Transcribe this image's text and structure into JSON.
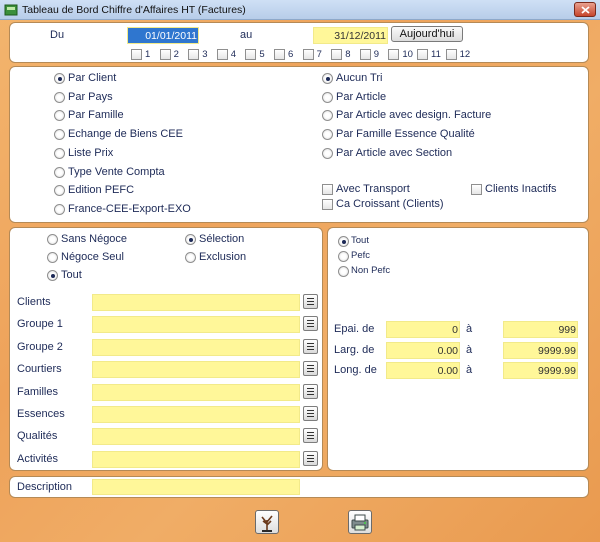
{
  "window": {
    "title": "Tableau de Bord Chiffre d'Affaires HT (Factures)"
  },
  "dates": {
    "du_label": "Du",
    "du_value": "01/01/2011",
    "au_label": "au",
    "au_value": "31/12/2011",
    "today_button": "Aujourd'hui"
  },
  "months": [
    "1",
    "2",
    "3",
    "4",
    "5",
    "6",
    "7",
    "8",
    "9",
    "10",
    "11",
    "12"
  ],
  "grouping": {
    "left": [
      {
        "label": "Par Client",
        "selected": true
      },
      {
        "label": "Par Pays",
        "selected": false
      },
      {
        "label": "Par Famille",
        "selected": false
      },
      {
        "label": "Echange de Biens CEE",
        "selected": false
      },
      {
        "label": "Liste Prix",
        "selected": false
      },
      {
        "label": "Type Vente Compta",
        "selected": false
      },
      {
        "label": "Edition PEFC",
        "selected": false
      },
      {
        "label": "France-CEE-Export-EXO",
        "selected": false
      }
    ],
    "sort": [
      {
        "label": "Aucun Tri",
        "selected": true
      },
      {
        "label": "Par Article",
        "selected": false
      },
      {
        "label": "Par Article avec design. Facture",
        "selected": false
      },
      {
        "label": "Par Famille Essence Qualité",
        "selected": false
      },
      {
        "label": "Par Article avec Section",
        "selected": false
      }
    ],
    "checks": {
      "avec_transport": "Avec Transport",
      "clients_inactifs": "Clients Inactifs",
      "ca_croissant": "Ca Croissant (Clients)"
    }
  },
  "negoce": {
    "sans_negoce": "Sans Négoce",
    "negoce_seul": "Négoce Seul",
    "tout": "Tout",
    "selection": "Sélection",
    "exclusion": "Exclusion"
  },
  "filters": [
    {
      "label": "Clients",
      "value": ""
    },
    {
      "label": "Groupe 1",
      "value": ""
    },
    {
      "label": "Groupe 2",
      "value": ""
    },
    {
      "label": "Courtiers",
      "value": ""
    },
    {
      "label": "Familles",
      "value": ""
    },
    {
      "label": "Essences",
      "value": ""
    },
    {
      "label": "Qualités",
      "value": ""
    },
    {
      "label": "Activités",
      "value": ""
    }
  ],
  "pefc": {
    "tout": "Tout",
    "pefc": "Pefc",
    "non_pefc": "Non Pefc"
  },
  "dimensions": [
    {
      "label": "Epai. de",
      "from": "0",
      "a": "à",
      "to": "999"
    },
    {
      "label": "Larg. de",
      "from": "0.00",
      "a": "à",
      "to": "9999.99"
    },
    {
      "label": "Long. de",
      "from": "0.00",
      "a": "à",
      "to": "9999.99"
    }
  ],
  "description": {
    "label": "Description",
    "value": ""
  },
  "colors": {
    "field_yellow": "#fff799",
    "text_navy": "#1d2a57",
    "selection_blue": "#2f76cf"
  }
}
